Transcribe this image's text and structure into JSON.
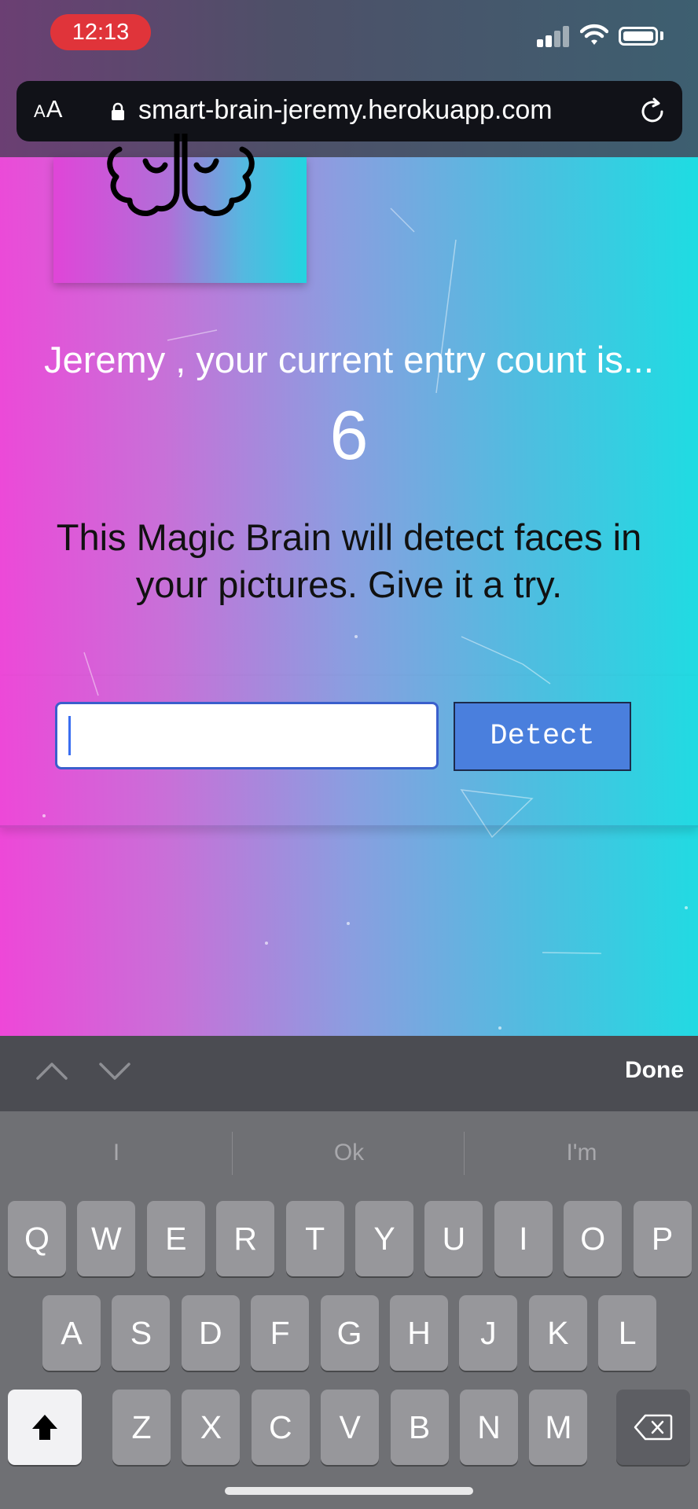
{
  "status_bar": {
    "time": "12:13"
  },
  "browser": {
    "text_size_label": "AA",
    "url": "smart-brain-jeremy.herokuapp.com"
  },
  "page": {
    "greeting": "Jeremy , your current entry count is...",
    "entry_count": "6",
    "description": "This Magic Brain will detect faces in your pictures. Give it a try.",
    "image_url_input": {
      "value": "",
      "placeholder": ""
    },
    "detect_button_label": "Detect"
  },
  "keyboard": {
    "toolbar": {
      "done_label": "Done"
    },
    "suggestions": [
      "I",
      "Ok",
      "I'm"
    ],
    "rows": [
      [
        "Q",
        "W",
        "E",
        "R",
        "T",
        "Y",
        "U",
        "I",
        "O",
        "P"
      ],
      [
        "A",
        "S",
        "D",
        "F",
        "G",
        "H",
        "J",
        "K",
        "L"
      ],
      [
        "Z",
        "X",
        "C",
        "V",
        "B",
        "N",
        "M"
      ]
    ]
  },
  "colors": {
    "gradient_left": "#f045d8",
    "gradient_right": "#1ddde2",
    "detect_button": "#4a7fdd",
    "time_pill": "#e0343a"
  },
  "icons": [
    "lock-icon",
    "reload-icon",
    "brain-icon",
    "chevron-up-icon",
    "chevron-down-icon",
    "shift-icon",
    "backspace-icon",
    "signal-icon",
    "wifi-icon",
    "battery-icon"
  ]
}
